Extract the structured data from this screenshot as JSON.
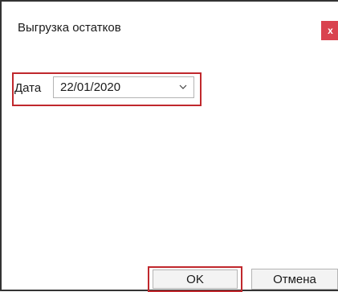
{
  "dialog": {
    "title": "Выгрузка остатков",
    "close_label": "x"
  },
  "date_field": {
    "label": "Дата",
    "value": "22/01/2020",
    "icon": "chevron-down-icon"
  },
  "buttons": {
    "ok_label": "OK",
    "cancel_label": "Отмена"
  },
  "colors": {
    "close_button": "#d9434f",
    "highlight": "#c0282d",
    "button_bg": "#f3f3f3",
    "border": "#b4b4b4"
  }
}
